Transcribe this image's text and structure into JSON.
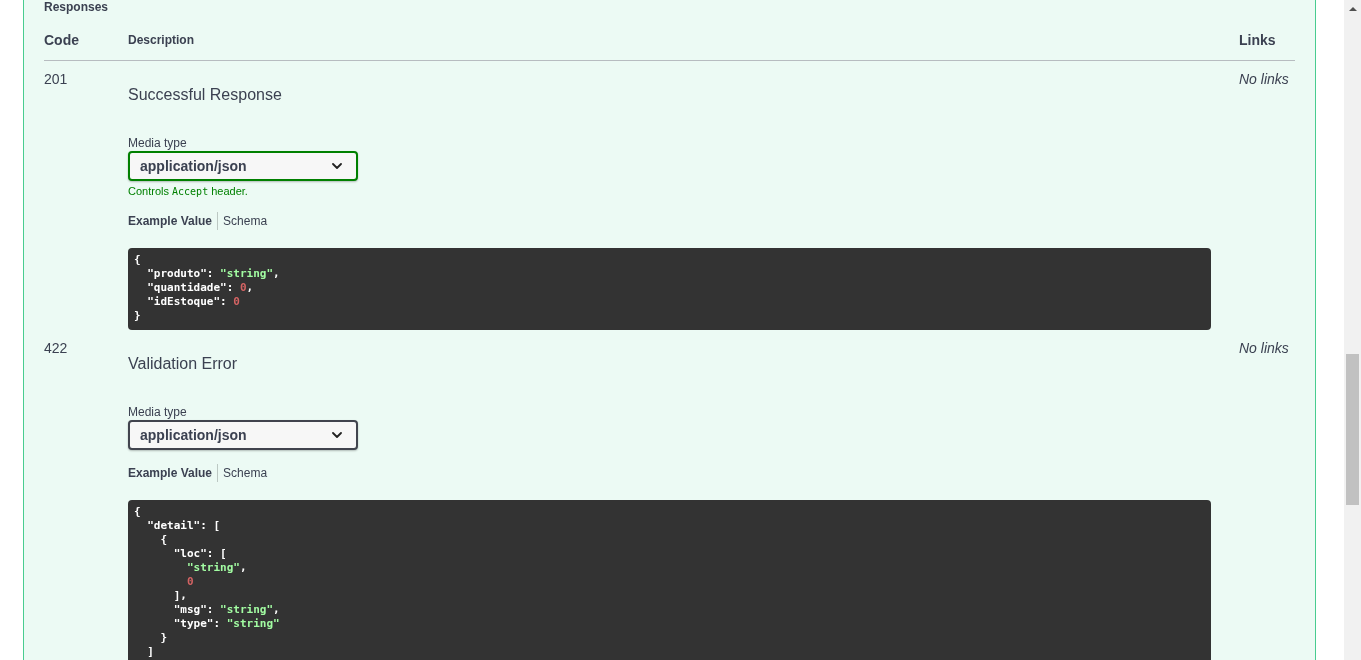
{
  "section": {
    "title": "Responses"
  },
  "table": {
    "columns": [
      "Code",
      "Description",
      "Links"
    ],
    "rows": [
      {
        "code": "201",
        "description": "Successful Response",
        "media_type": {
          "label": "Media type",
          "value": "application/json",
          "controls_accept": true,
          "hint": [
            {
              "kind": "text",
              "text": "Controls "
            },
            {
              "kind": "code",
              "text": "Accept"
            },
            {
              "kind": "text",
              "text": " header."
            }
          ]
        },
        "example_tabs": [
          {
            "label": "Example Value",
            "selected": true
          },
          {
            "label": "Schema",
            "selected": false
          }
        ],
        "example": [
          [
            {
              "kind": "punct",
              "text": "{"
            }
          ],
          [
            {
              "kind": "key",
              "text": "  \"produto\""
            },
            {
              "kind": "punct",
              "text": ": "
            },
            {
              "kind": "string",
              "text": "\"string\""
            },
            {
              "kind": "punct",
              "text": ","
            }
          ],
          [
            {
              "kind": "key",
              "text": "  \"quantidade\""
            },
            {
              "kind": "punct",
              "text": ": "
            },
            {
              "kind": "number",
              "text": "0"
            },
            {
              "kind": "punct",
              "text": ","
            }
          ],
          [
            {
              "kind": "key",
              "text": "  \"idEstoque\""
            },
            {
              "kind": "punct",
              "text": ": "
            },
            {
              "kind": "number",
              "text": "0"
            }
          ],
          [
            {
              "kind": "punct",
              "text": "}"
            }
          ]
        ],
        "links": "No links"
      },
      {
        "code": "422",
        "description": "Validation Error",
        "media_type": {
          "label": "Media type",
          "value": "application/json",
          "controls_accept": false
        },
        "example_tabs": [
          {
            "label": "Example Value",
            "selected": true
          },
          {
            "label": "Schema",
            "selected": false
          }
        ],
        "example": [
          [
            {
              "kind": "punct",
              "text": "{"
            }
          ],
          [
            {
              "kind": "key",
              "text": "  \"detail\""
            },
            {
              "kind": "punct",
              "text": ": ["
            }
          ],
          [
            {
              "kind": "punct",
              "text": "    {"
            }
          ],
          [
            {
              "kind": "key",
              "text": "      \"loc\""
            },
            {
              "kind": "punct",
              "text": ": ["
            }
          ],
          [
            {
              "kind": "string",
              "text": "        \"string\""
            },
            {
              "kind": "punct",
              "text": ","
            }
          ],
          [
            {
              "kind": "number",
              "text": "        0"
            }
          ],
          [
            {
              "kind": "punct",
              "text": "      ],"
            }
          ],
          [
            {
              "kind": "key",
              "text": "      \"msg\""
            },
            {
              "kind": "punct",
              "text": ": "
            },
            {
              "kind": "string",
              "text": "\"string\""
            },
            {
              "kind": "punct",
              "text": ","
            }
          ],
          [
            {
              "kind": "key",
              "text": "      \"type\""
            },
            {
              "kind": "punct",
              "text": ": "
            },
            {
              "kind": "string",
              "text": "\"string\""
            }
          ],
          [
            {
              "kind": "punct",
              "text": "    }"
            }
          ],
          [
            {
              "kind": "punct",
              "text": "  ]"
            }
          ]
        ],
        "links": "No links"
      }
    ]
  }
}
